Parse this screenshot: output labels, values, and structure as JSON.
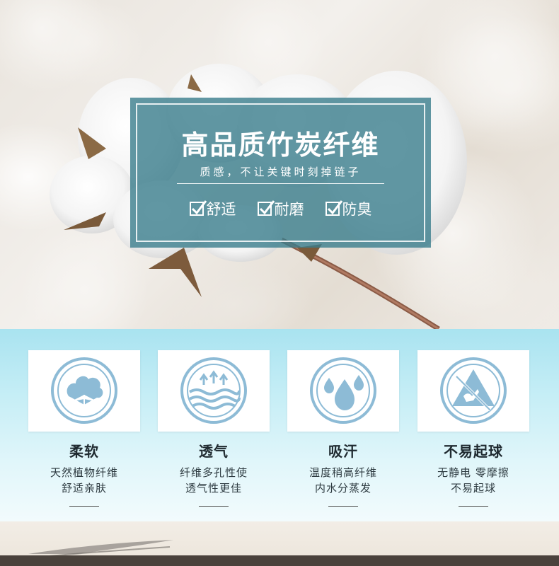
{
  "banner": {
    "title": "高品质竹炭纤维",
    "subtitle": "质感，不让关键时刻掉链子",
    "checks": [
      {
        "label": "舒适"
      },
      {
        "label": "耐磨"
      },
      {
        "label": "防臭"
      }
    ]
  },
  "features": [
    {
      "icon": "cotton-icon",
      "title": "柔软",
      "desc_line1": "天然植物纤维",
      "desc_line2": "舒适亲肤"
    },
    {
      "icon": "breathable-arrows-icon",
      "title": "透气",
      "desc_line1": "纤维多孔性使",
      "desc_line2": "透气性更佳"
    },
    {
      "icon": "water-drops-icon",
      "title": "吸汗",
      "desc_line1": "温度稍高纤维",
      "desc_line2": "内水分蒸发"
    },
    {
      "icon": "anti-static-icon",
      "title": "不易起球",
      "desc_line1": "无静电 零摩擦",
      "desc_line2": "不易起球"
    }
  ],
  "colors": {
    "banner_bg": "#3a7d8c",
    "feature_bg_top": "#a9e3f0",
    "icon_blue": "#8dbbd6"
  }
}
